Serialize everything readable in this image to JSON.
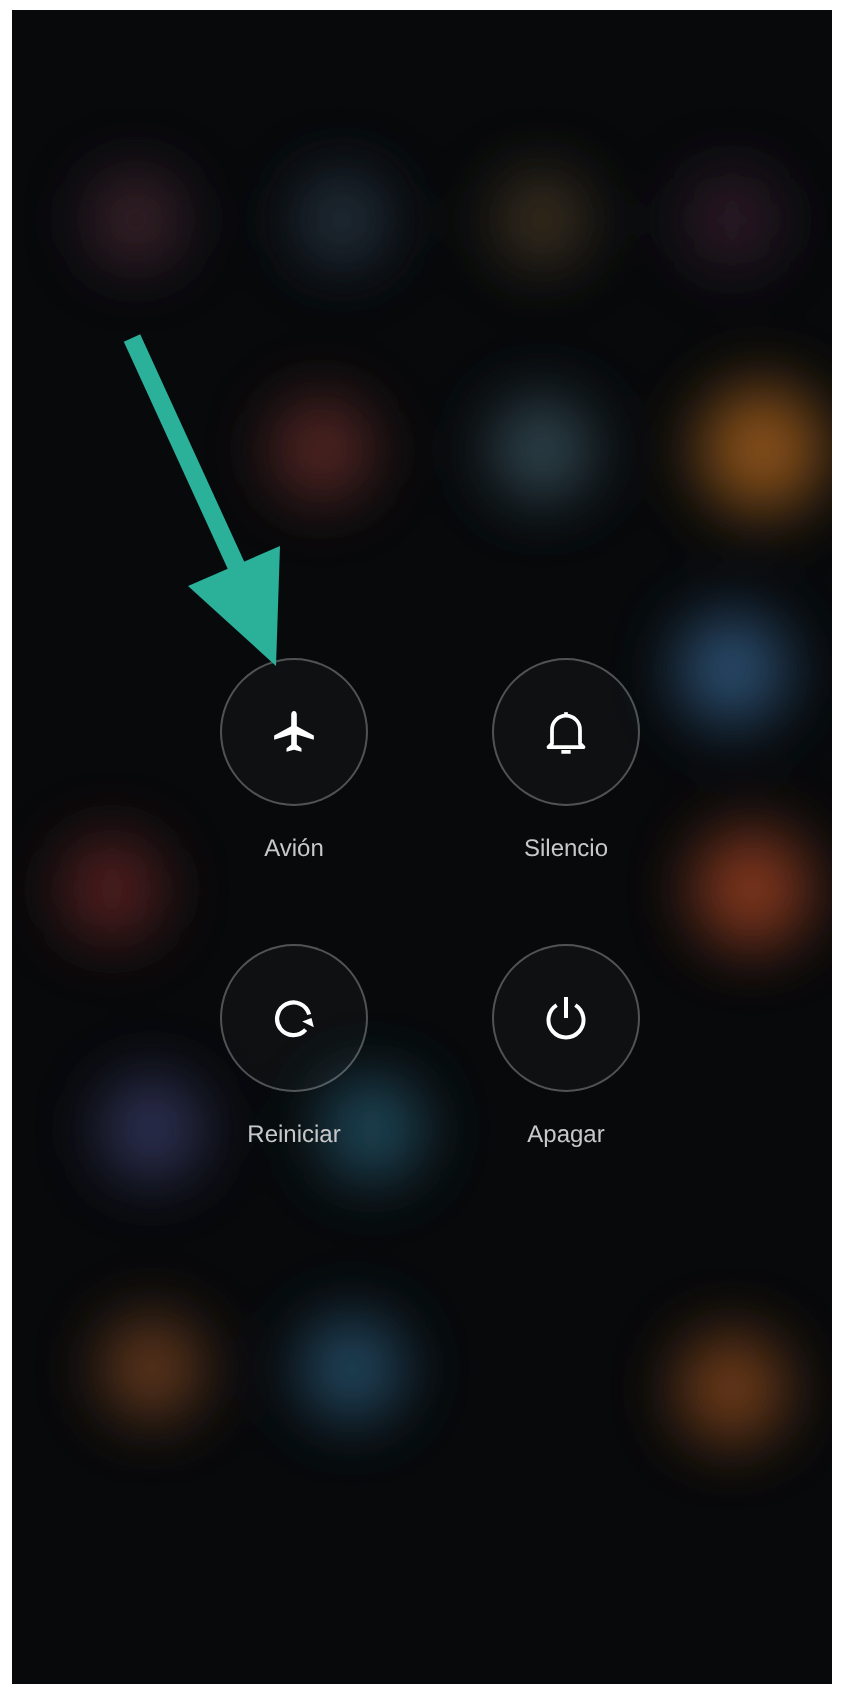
{
  "power_menu": {
    "buttons": [
      {
        "label": "Avión",
        "kind": "airplane"
      },
      {
        "label": "Silencio",
        "kind": "bell"
      },
      {
        "label": "Reiniciar",
        "kind": "restart"
      },
      {
        "label": "Apagar",
        "kind": "power"
      }
    ]
  }
}
